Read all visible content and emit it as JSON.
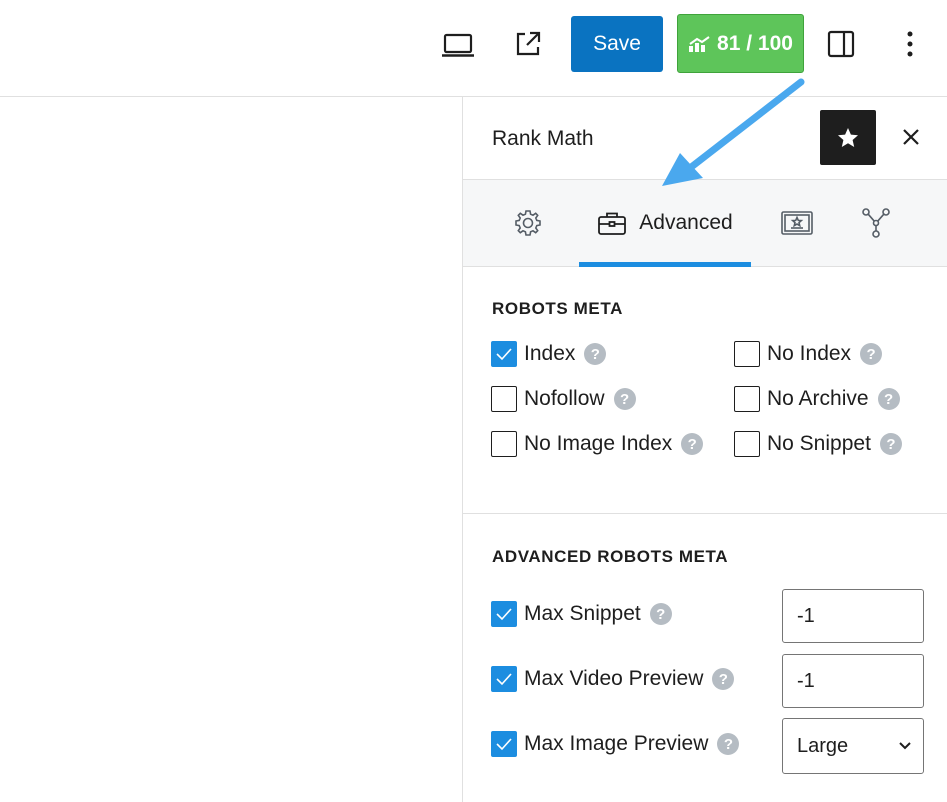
{
  "toolbar": {
    "save_label": "Save",
    "score_text": "81 / 100",
    "score_color": "#5ec55a",
    "save_color": "#0a73c1",
    "icons": [
      "laptop-icon",
      "external-link-icon",
      "score-chart-icon",
      "sidebar-toggle-icon",
      "more-vertical-icon"
    ]
  },
  "panel": {
    "title": "Rank Math",
    "tabs": [
      {
        "name": "general",
        "icon": "gear-icon",
        "label": ""
      },
      {
        "name": "advanced",
        "icon": "briefcase-icon",
        "label": "Advanced",
        "active": true
      },
      {
        "name": "schema",
        "icon": "schema-icon",
        "label": ""
      },
      {
        "name": "social",
        "icon": "share-icon",
        "label": ""
      }
    ],
    "accent_color": "#1c8de0"
  },
  "robots_meta": {
    "title": "ROBOTS META",
    "items": [
      {
        "label": "Index",
        "checked": true
      },
      {
        "label": "No Index",
        "checked": false
      },
      {
        "label": "Nofollow",
        "checked": false
      },
      {
        "label": "No Archive",
        "checked": false
      },
      {
        "label": "No Image Index",
        "checked": false
      },
      {
        "label": "No Snippet",
        "checked": false
      }
    ]
  },
  "advanced_robots_meta": {
    "title": "ADVANCED ROBOTS META",
    "max_snippet": {
      "label": "Max Snippet",
      "checked": true,
      "value": "-1"
    },
    "max_video_preview": {
      "label": "Max Video Preview",
      "checked": true,
      "value": "-1"
    },
    "max_image_preview": {
      "label": "Max Image Preview",
      "checked": true,
      "value": "Large",
      "options": [
        "Large"
      ]
    }
  }
}
